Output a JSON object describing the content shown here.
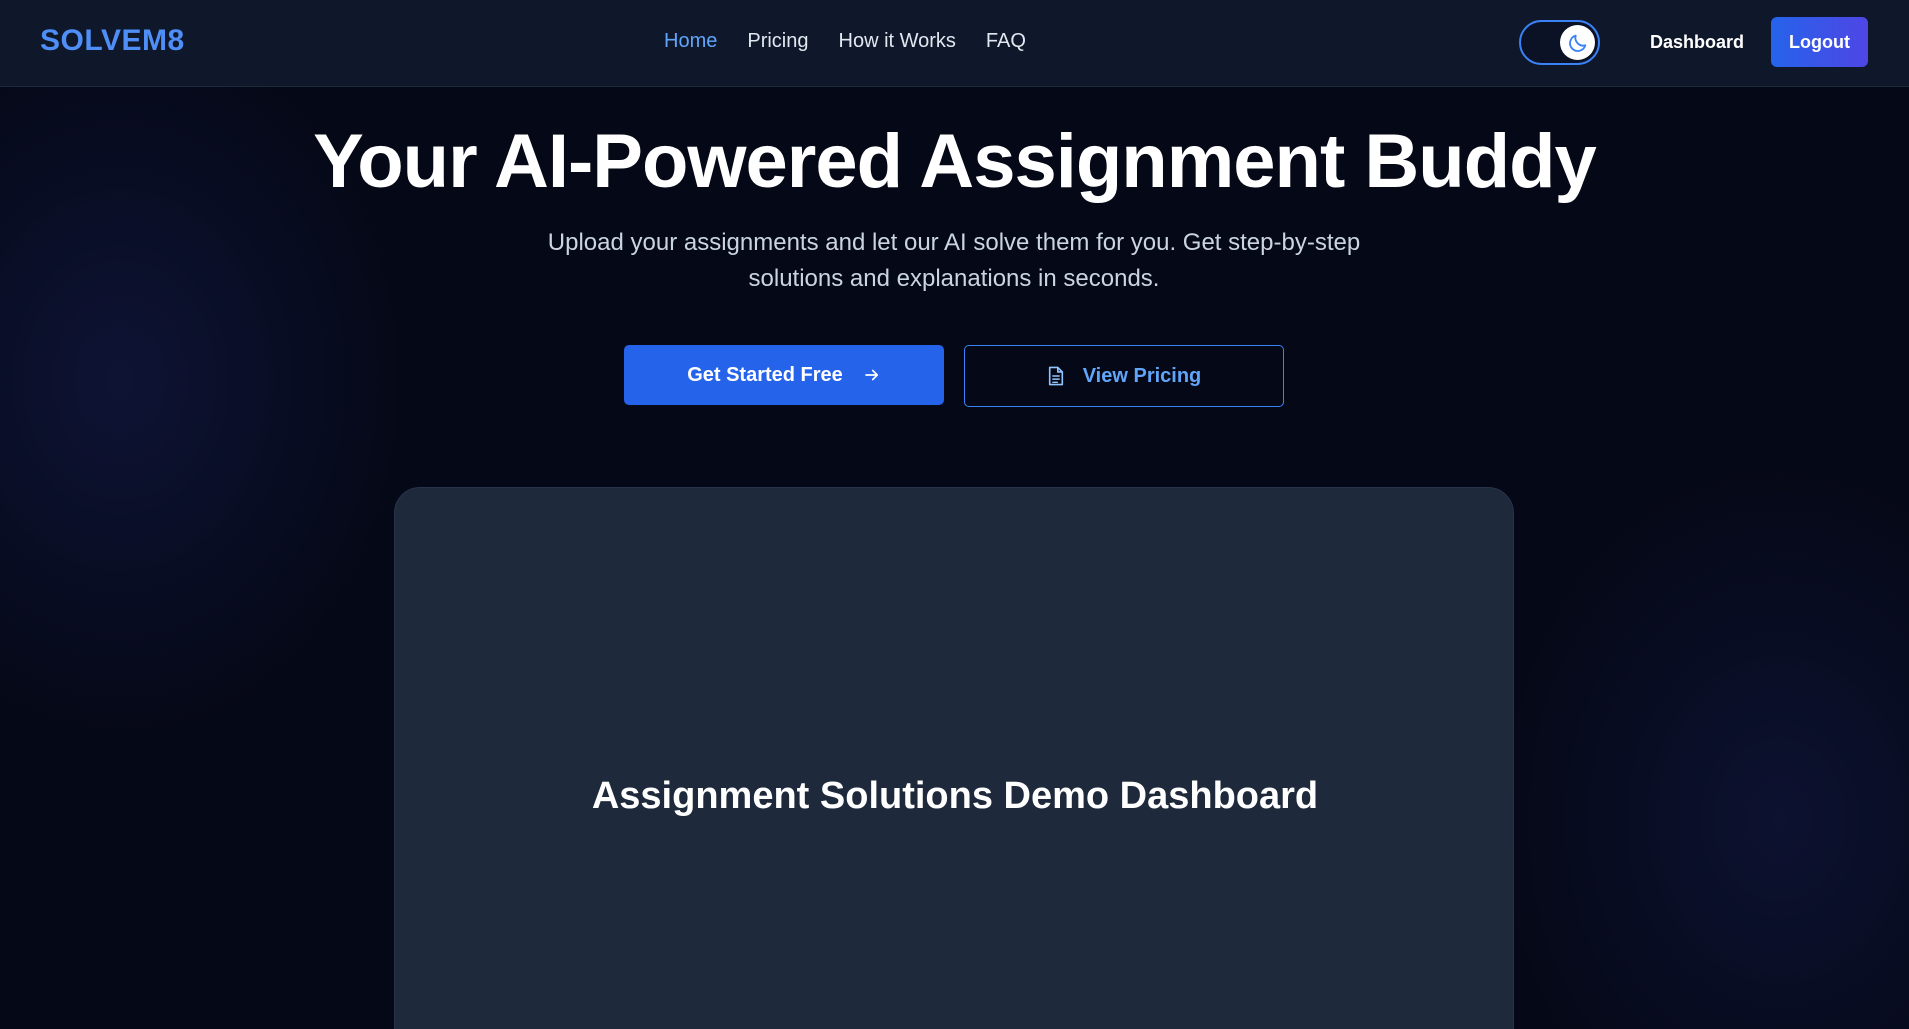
{
  "brand": {
    "name": "SOLVEM8"
  },
  "nav": {
    "items": [
      {
        "label": "Home",
        "active": true
      },
      {
        "label": "Pricing",
        "active": false
      },
      {
        "label": "How it Works",
        "active": false
      },
      {
        "label": "FAQ",
        "active": false
      }
    ]
  },
  "header_actions": {
    "theme_toggle_icon": "moon-icon",
    "dashboard_label": "Dashboard",
    "logout_label": "Logout"
  },
  "hero": {
    "title": "Your AI-Powered Assignment Buddy",
    "subtitle": "Upload your assignments and let our AI solve them for you. Get step-by-step solutions and explanations in seconds.",
    "primary_cta": {
      "label": "Get Started Free",
      "icon": "arrow-right-icon"
    },
    "secondary_cta": {
      "label": "View Pricing",
      "icon": "document-icon"
    }
  },
  "demo": {
    "title": "Assignment Solutions Demo Dashboard"
  },
  "colors": {
    "background": "#050816",
    "navbar": "#0f172a",
    "accent": "#2563eb",
    "accent_light": "#60a5fa",
    "card": "#1e293b"
  }
}
